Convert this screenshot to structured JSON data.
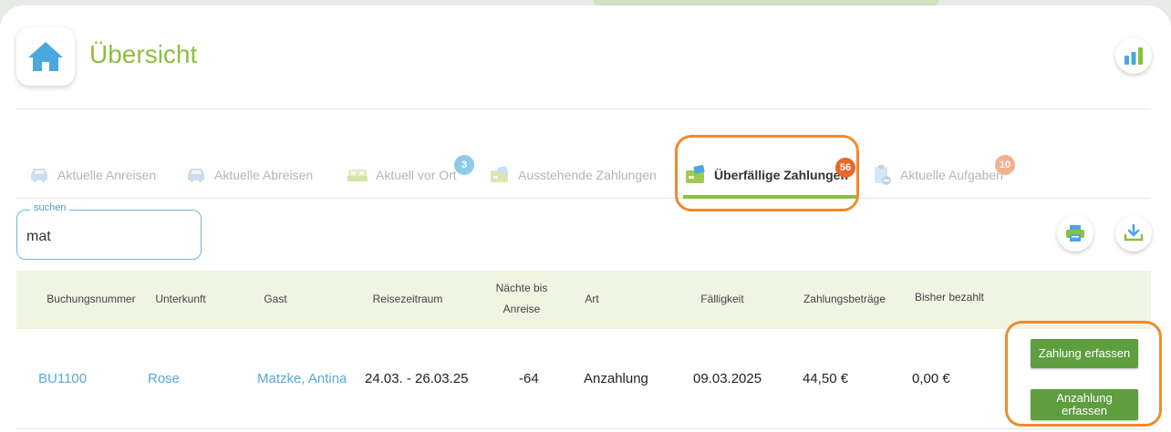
{
  "header": {
    "title": "Übersicht"
  },
  "tabs": [
    {
      "label": "Aktuelle Anreisen",
      "icon": "car-icon",
      "badge": ""
    },
    {
      "label": "Aktuelle Abreisen",
      "icon": "car-icon",
      "badge": ""
    },
    {
      "label": "Aktuell vor Ort",
      "icon": "bed-icon",
      "badge": "3"
    },
    {
      "label": "Ausstehende Zahlungen",
      "icon": "payment-card-icon",
      "badge": ""
    },
    {
      "label": "Überfällige Zahlungen",
      "icon": "payment-card-icon",
      "badge": "56",
      "active": true
    },
    {
      "label": "Aktuelle Aufgaben",
      "icon": "clipboard-icon",
      "badge": "10"
    }
  ],
  "search": {
    "legend": "suchen",
    "value": "mat"
  },
  "table": {
    "headers": {
      "booking": "Buchungsnummer",
      "accommodation": "Unterkunft",
      "guest": "Gast",
      "period": "Reisezeitraum",
      "nights_line1": "Nächte bis",
      "nights_line2": "Anreise",
      "type": "Art",
      "due": "Fälligkeit",
      "amounts": "Zahlungsbeträge",
      "paid": "Bisher bezahlt"
    },
    "rows": [
      {
        "booking": "BU1100",
        "accommodation": "Rose",
        "guest": "Matzke, Antina",
        "period": "24.03. - 26.03.25",
        "nights": "-64",
        "type": "Anzahlung",
        "due": "09.03.2025",
        "amount": "44,50 €",
        "paid": "0,00 €",
        "btn_payment": "Zahlung erfassen",
        "btn_deposit_line1": "Anzahlung",
        "btn_deposit_line2": "erfassen"
      }
    ]
  },
  "colors": {
    "accent_green": "#8cbf3f",
    "link_blue": "#5aa8d8",
    "badge_blue": "#8fcbe8",
    "badge_orange_red": "#e8672b",
    "badge_peach": "#f4b08a",
    "highlight_orange": "#f08a2c",
    "button_green": "#5e9e3f"
  }
}
